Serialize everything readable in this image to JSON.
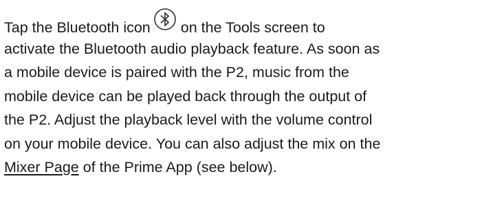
{
  "paragraph": {
    "line1_before_icon": "Tap the Bluetooth icon",
    "line1_after_icon": "on the Tools screen to",
    "icon": "bluetooth-icon",
    "line2": "activate the Bluetooth audio playback feature. As soon as",
    "line3": "a mobile device is paired with the P2, music from the",
    "line4": "mobile device can be played back through the output of",
    "line5": "the P2. Adjust the playback level with the volume control",
    "line6": "on your mobile device. You can also adjust the mix on the",
    "line7_link": "Mixer Page",
    "line7_after_link": "of the Prime App (see below)."
  }
}
